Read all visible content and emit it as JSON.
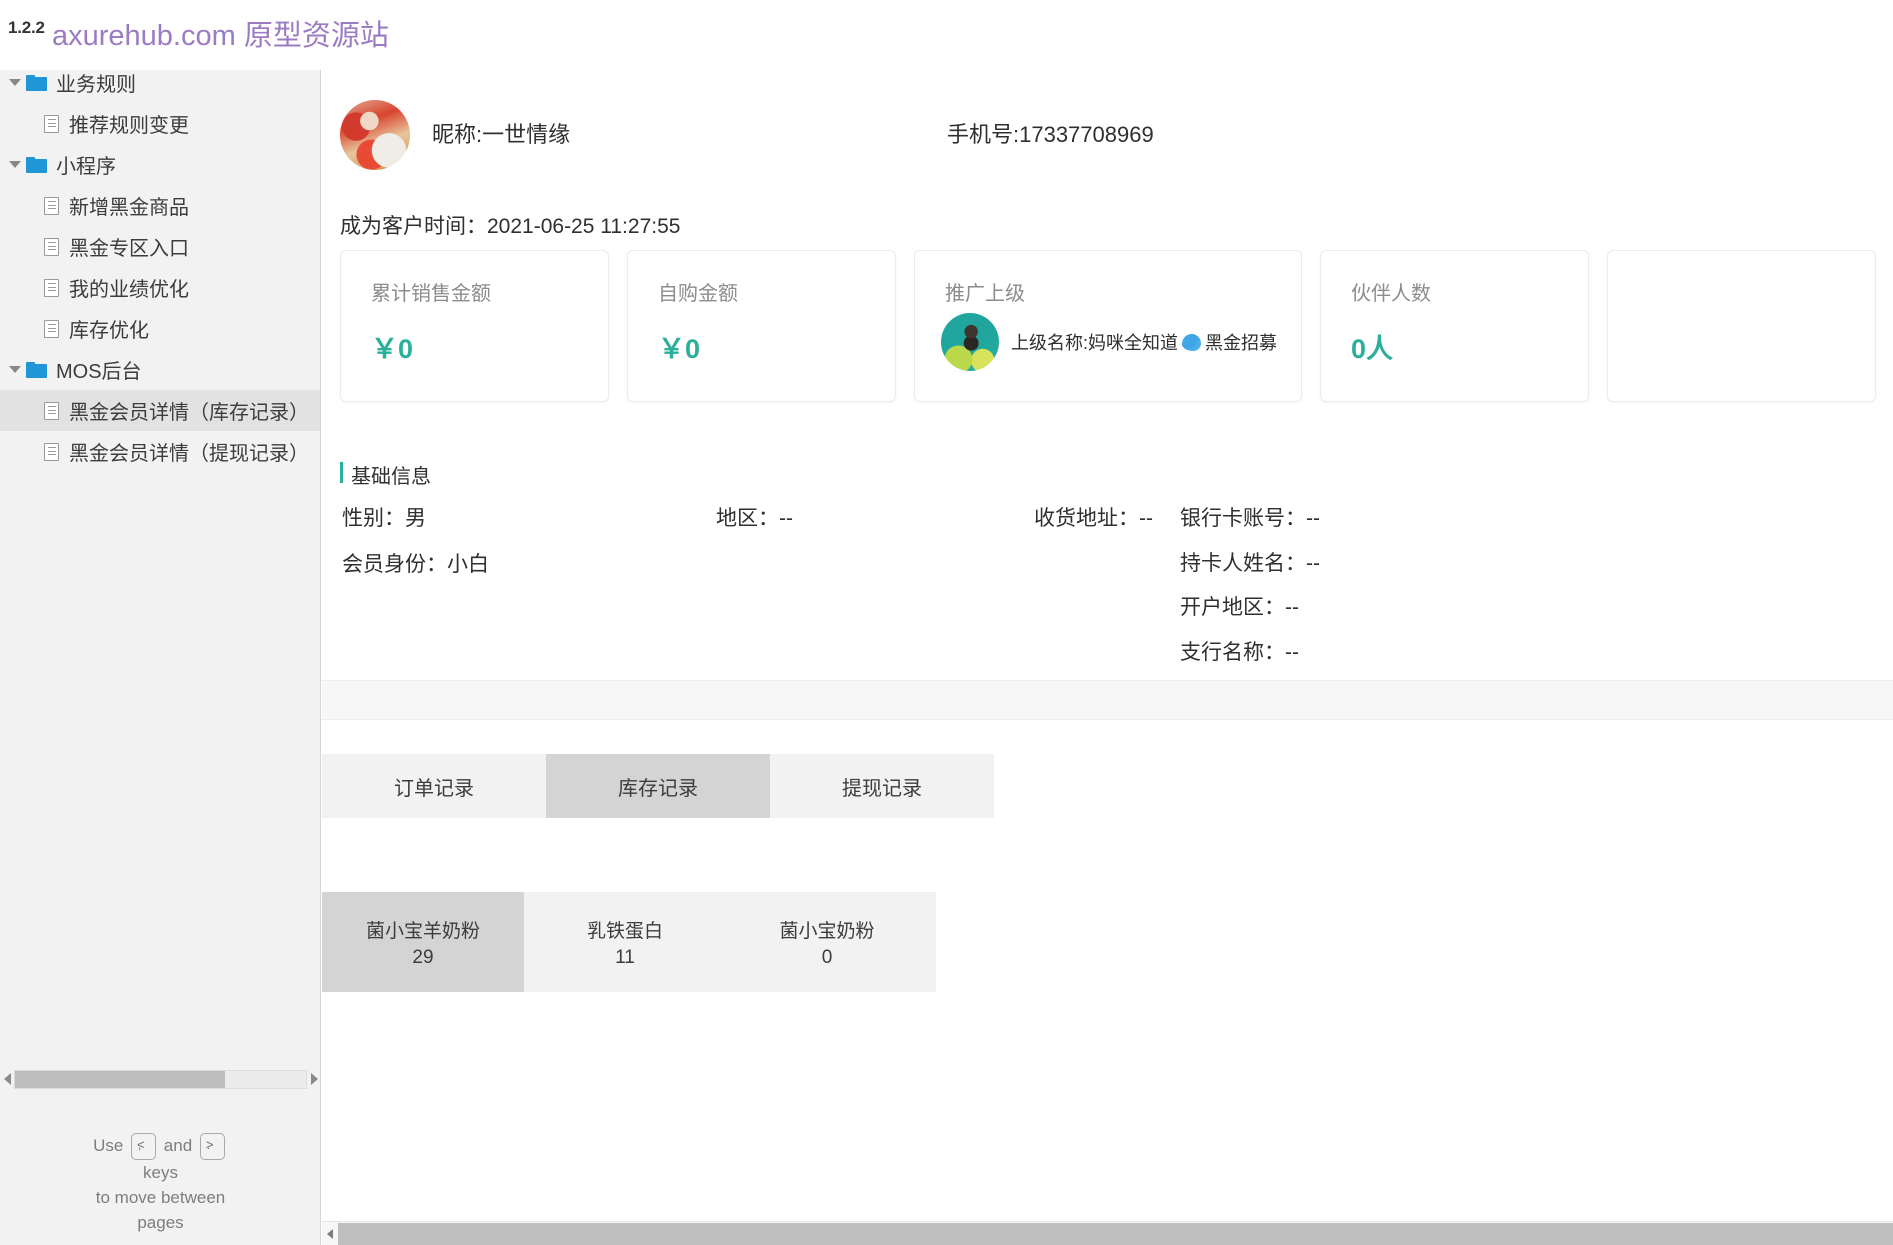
{
  "watermark": {
    "version": "1.2.2",
    "text": "axurehub.com 原型资源站"
  },
  "sidebar": {
    "tree": [
      {
        "level": 0,
        "type": "folder",
        "label": "业务规则",
        "expanded": true,
        "selected": false
      },
      {
        "level": 1,
        "type": "page",
        "label": "推荐规则变更",
        "selected": false
      },
      {
        "level": 0,
        "type": "folder",
        "label": "小程序",
        "expanded": true,
        "selected": false
      },
      {
        "level": 1,
        "type": "page",
        "label": "新增黑金商品",
        "selected": false
      },
      {
        "level": 1,
        "type": "page",
        "label": "黑金专区入口",
        "selected": false
      },
      {
        "level": 1,
        "type": "page",
        "label": "我的业绩优化",
        "selected": false
      },
      {
        "level": 1,
        "type": "page",
        "label": "库存优化",
        "selected": false
      },
      {
        "level": 0,
        "type": "folder",
        "label": "MOS后台",
        "expanded": true,
        "selected": false
      },
      {
        "level": 1,
        "type": "page",
        "label": "黑金会员详情（库存记录）",
        "selected": true
      },
      {
        "level": 1,
        "type": "page",
        "label": "黑金会员详情（提现记录）",
        "selected": false
      }
    ],
    "hint": {
      "use": "Use",
      "and": "and",
      "key_prev_upper": "<",
      "key_prev_lower": ",",
      "key_next_upper": ">",
      "key_next_lower": ".",
      "keys_word": "keys",
      "line2": "to move between",
      "line3": "pages"
    }
  },
  "profile": {
    "nickname": "昵称:一世情缘",
    "phone": "手机号:17337708969",
    "become_customer_time": "成为客户时间：2021-06-25 11:27:55"
  },
  "stat_cards": [
    {
      "title": "累计销售金额",
      "value": "￥0"
    },
    {
      "title": "自购金额",
      "value": "￥0"
    },
    {
      "title": "推广上级",
      "superior_prefix": "上级名称:妈咪全知道",
      "superior_suffix": "黑金招募"
    },
    {
      "title": "伙伴人数",
      "value": "0人"
    }
  ],
  "basic_info": {
    "section_title": "基础信息",
    "gender": "性别：男",
    "identity": "会员身份：小白",
    "region": "地区：--",
    "address": "收货地址：--",
    "bank_account": "银行卡账号：--",
    "card_holder": "持卡人姓名：--",
    "open_area": "开户地区：--",
    "branch_name": "支行名称：--"
  },
  "tabs": [
    {
      "label": "订单记录",
      "active": false
    },
    {
      "label": "库存记录",
      "active": true
    },
    {
      "label": "提现记录",
      "active": false
    }
  ],
  "inventory": [
    {
      "name": "菌小宝羊奶粉",
      "count": "29",
      "selected": true
    },
    {
      "name": "乳铁蛋白",
      "count": "11",
      "selected": false
    },
    {
      "name": "菌小宝奶粉",
      "count": "0",
      "selected": false
    }
  ],
  "colors": {
    "accent_teal": "#2ab09a",
    "watermark_purple": "#9b7cc4",
    "folder_blue": "#2196d6"
  }
}
